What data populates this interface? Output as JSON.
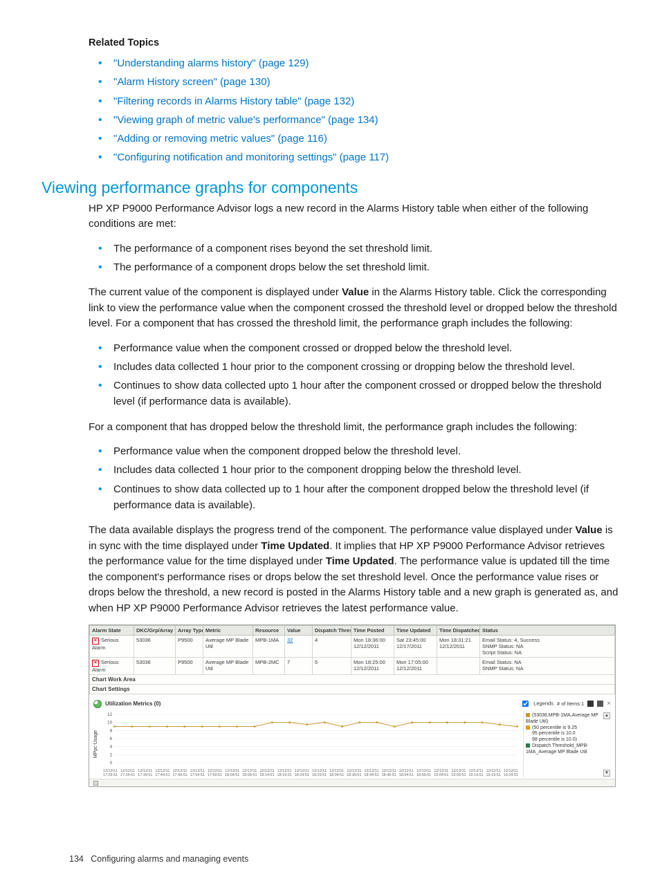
{
  "related": {
    "heading": "Related Topics",
    "items": [
      "\"Understanding alarms history\" (page 129)",
      "\"Alarm History screen\" (page 130)",
      "\"Filtering records in Alarms History table\" (page 132)",
      "\"Viewing graph of metric value's performance\" (page 134)",
      "\"Adding or removing metric values\" (page 116)",
      "\"Configuring notification and monitoring settings\" (page 117)"
    ]
  },
  "section": {
    "title": "Viewing performance graphs for components",
    "para1": "HP XP P9000 Performance Advisor logs a new record in the Alarms History table when either of the following conditions are met:",
    "cond": [
      "The performance of a component rises beyond the set threshold limit.",
      "The performance of a component drops below the set threshold limit."
    ],
    "para2a": "The current value of the component is displayed under ",
    "para2b": " in the Alarms History table. Click the corresponding link to view the performance value when the component crossed the threshold level or dropped below the threshold level. For a component that has crossed the threshold limit, the performance graph includes the following:",
    "crossed": [
      "Performance value when the component crossed or dropped below the threshold level.",
      "Includes data collected 1 hour prior to the component crossing or dropping below the threshold level.",
      "Continues to show data collected upto 1 hour after the component crossed or dropped below the threshold level (if performance data is available)."
    ],
    "para3": "For a component that has dropped below the threshold limit, the performance graph includes the following:",
    "dropped": [
      "Performance value when the component dropped below the threshold level.",
      "Includes data collected 1 hour prior to the component dropping below the threshold level.",
      "Continues to show data collected up to 1 hour after the component dropped below the threshold level (if performance data is available)."
    ],
    "para4a": "The data available displays the progress trend of the component. The performance value displayed under ",
    "para4b": " is in sync with the time displayed under ",
    "para4c": ". It implies that HP XP P9000 Performance Advisor retrieves the performance value for the time displayed under ",
    "para4d": ". The performance value is updated till the time the component's performance rises or drops below the set threshold level. Once the performance value rises or drops below the threshold, a new record is posted in the Alarms History table and a new graph is generated as, and when HP XP P9000 Performance Advisor retrieves the latest performance value.",
    "bold_value": "Value",
    "bold_tu": "Time Updated"
  },
  "footer": {
    "page": "134",
    "chapter": "Configuring alarms and managing events"
  },
  "fig": {
    "table": {
      "headers": [
        "Alarm State",
        "DKC/Grp/Array …",
        "Array Type",
        "Metric",
        "Resource",
        "Value",
        "Dispatch Thres…",
        "Time Posted",
        "Time Updated",
        "Time Dispatched",
        "Status"
      ],
      "rows": [
        {
          "state": "Serious Alarm",
          "dkc": "53036",
          "atype": "P9500",
          "metric": "Average MP Blade Util",
          "res": "MPB-1MA",
          "val": "32",
          "dthres": "4",
          "tposted": "Mon 18:36:00 12/12/2011",
          "tupd": "Sat 23:45:00 12/17/2011",
          "tdisp": "Mon 18:31:21 12/12/2011",
          "status": "Email Status: 4, Success\nSNMP Status: NA\nScript Status: NA"
        },
        {
          "state": "Serious Alarm",
          "dkc": "53036",
          "atype": "P9500",
          "metric": "Average MP Blade Util",
          "res": "MPB-2MC",
          "val": "7",
          "dthres": "5",
          "tposted": "Mon 18:25:00 12/12/2011",
          "tupd": "Mon 17:05:00 12/12/2011",
          "tdisp": "",
          "status": "Email Status: NA\nSNMP Status: NA"
        }
      ]
    },
    "tabs": {
      "a": "Chart Work Area",
      "b": "Chart Settings"
    },
    "chart": {
      "title": "Utilization Metrics (0)",
      "legend_cb": "Legends",
      "items_count": "# of Items:1",
      "ylabel": "MPpc Usage",
      "legend": [
        {
          "color": "#c99a2e",
          "text": "(53036,MPB-1MA,Average MP Blade Util)"
        },
        {
          "color": "#e39a17",
          "text": "(50 percentile is 9.25"
        },
        {
          "color": "",
          "text": "95 percentile is 10.0"
        },
        {
          "color": "",
          "text": "98 percentile is 10.0)"
        },
        {
          "color": "#2a7a4a",
          "text": "Dispatch Threshold_MPB-1MA_Average MP Blade Util"
        }
      ]
    }
  },
  "chart_data": {
    "type": "line",
    "title": "Utilization Metrics (0)",
    "ylabel": "MPpc Usage",
    "ylim": [
      0,
      12
    ],
    "yticks": [
      0,
      2,
      4,
      6,
      8,
      10,
      12
    ],
    "x": [
      "12/12/11 17:29:51",
      "12/12/11 17:34:51",
      "12/12/11 17:39:51",
      "12/12/11 17:44:51",
      "12/12/11 17:49:51",
      "12/12/11 17:54:51",
      "12/12/11 17:59:51",
      "12/12/11 18:04:51",
      "12/12/11 18:09:51",
      "12/12/11 18:14:51",
      "12/12/11 18:19:51",
      "12/12/11 18:24:51",
      "12/12/11 18:29:51",
      "12/12/11 18:34:51",
      "12/12/11 18:39:51",
      "12/12/11 18:44:51",
      "12/12/11 18:49:51",
      "12/12/11 18:54:51",
      "12/12/11 18:59:51",
      "12/12/11 19:04:51",
      "12/12/11 19:09:51",
      "12/12/11 19:14:51",
      "12/12/11 19:19:51",
      "12/12/11 19:24:51"
    ],
    "series": [
      {
        "name": "(53036,MPB-1MA,Average MP Blade Util)",
        "color": "#c99a2e",
        "values": [
          9,
          9,
          9,
          9,
          9,
          9,
          9,
          9,
          9,
          10,
          10,
          9.5,
          10,
          9,
          10,
          10,
          9,
          10,
          10,
          10,
          10,
          10,
          9.5,
          9
        ]
      },
      {
        "name": "Dispatch Threshold_MPB-1MA_Average MP Blade Util",
        "color": "#2a7a4a",
        "style": "hidden-off-bottom",
        "values": [
          0,
          0,
          0,
          0,
          0,
          0,
          0,
          0,
          0,
          0,
          0,
          0,
          0,
          0,
          0,
          0,
          0,
          0,
          0,
          0,
          0,
          0,
          0,
          0
        ]
      }
    ],
    "annotations": {
      "50_percentile": 9.25,
      "95_percentile": 10.0,
      "98_percentile": 10.0
    }
  }
}
